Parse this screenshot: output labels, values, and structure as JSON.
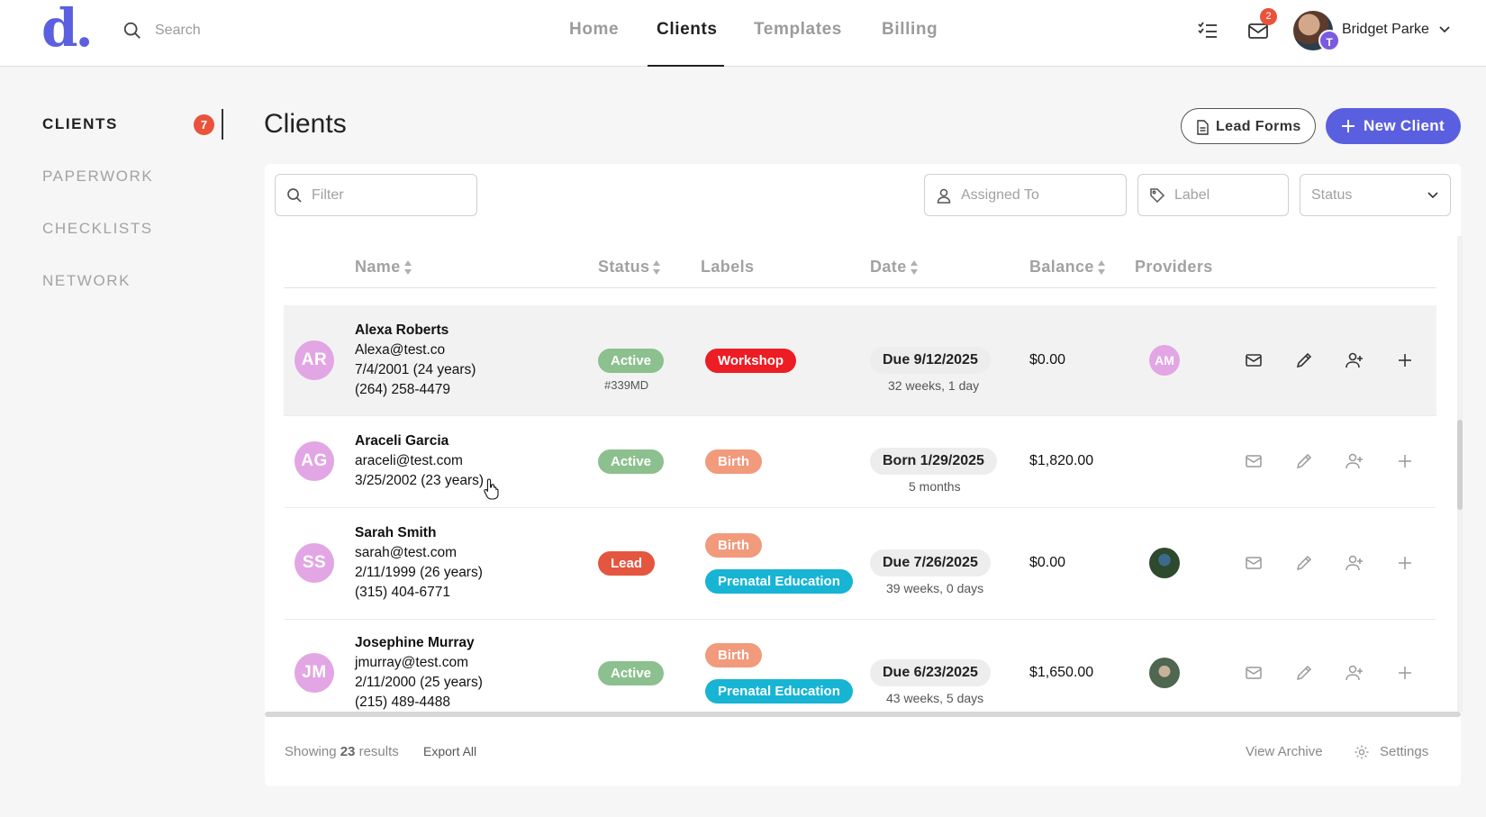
{
  "brand": {
    "logo_text": "d.",
    "accent": "#5a5fe0"
  },
  "header": {
    "search_placeholder": "Search",
    "nav": [
      "Home",
      "Clients",
      "Templates",
      "Billing"
    ],
    "active_nav": "Clients",
    "mail_badge": "2",
    "user_initial": "T",
    "user_name": "Bridget Parke"
  },
  "sidebar": {
    "items": [
      "CLIENTS",
      "PAPERWORK",
      "CHECKLISTS",
      "NETWORK"
    ],
    "clients_badge": "7"
  },
  "page": {
    "title": "Clients",
    "lead_forms_label": "Lead Forms",
    "new_client_label": "New Client"
  },
  "filters": {
    "filter_placeholder": "Filter",
    "assigned_placeholder": "Assigned To",
    "label_placeholder": "Label",
    "status_placeholder": "Status"
  },
  "table": {
    "columns": [
      "Name",
      "Status",
      "Labels",
      "Date",
      "Balance",
      "Providers"
    ],
    "rows": [
      {
        "initials": "AR",
        "name": "Alexa Roberts",
        "email": "Alexa@test.co",
        "dob": "7/4/2001 (24 years)",
        "phone": "(264) 258-4479",
        "status": "Active",
        "status_sub": "#339MD",
        "labels": [
          "Workshop"
        ],
        "date": "Due 9/12/2025",
        "date_sub": "32 weeks, 1 day",
        "balance": "$0.00",
        "provider": "AM"
      },
      {
        "initials": "AG",
        "name": "Araceli Garcia",
        "email": "araceli@test.com",
        "dob": "3/25/2002 (23 years)",
        "phone": "",
        "status": "Active",
        "status_sub": "",
        "labels": [
          "Birth"
        ],
        "date": "Born 1/29/2025",
        "date_sub": "5 months",
        "balance": "$1,820.00",
        "provider": ""
      },
      {
        "initials": "SS",
        "name": "Sarah Smith",
        "email": "sarah@test.com",
        "dob": "2/11/1999 (26 years)",
        "phone": "(315) 404-6771",
        "status": "Lead",
        "status_sub": "",
        "labels": [
          "Birth",
          "Prenatal Education"
        ],
        "date": "Due 7/26/2025",
        "date_sub": "39 weeks, 0 days",
        "balance": "$0.00",
        "provider": "photo"
      },
      {
        "initials": "JM",
        "name": "Josephine Murray",
        "email": "jmurray@test.com",
        "dob": "2/11/2000 (25 years)",
        "phone": "(215) 489-4488",
        "status": "Active",
        "status_sub": "",
        "labels": [
          "Birth",
          "Prenatal Education"
        ],
        "date": "Due 6/23/2025",
        "date_sub": "43 weeks, 5 days",
        "balance": "$1,650.00",
        "provider": "photo"
      }
    ]
  },
  "footer": {
    "showing_prefix": "Showing",
    "showing_count": "23",
    "showing_suffix": "results",
    "export_label": "Export All",
    "archive_label": "View Archive",
    "settings_label": "Settings"
  },
  "colors": {
    "active": "#8cc08e",
    "lead": "#e4563f",
    "workshop": "#ec1d24",
    "birth": "#f19a7c",
    "prenatal": "#17b4d4",
    "badge": "#e9533b",
    "avatar": "#e2a6e4"
  }
}
